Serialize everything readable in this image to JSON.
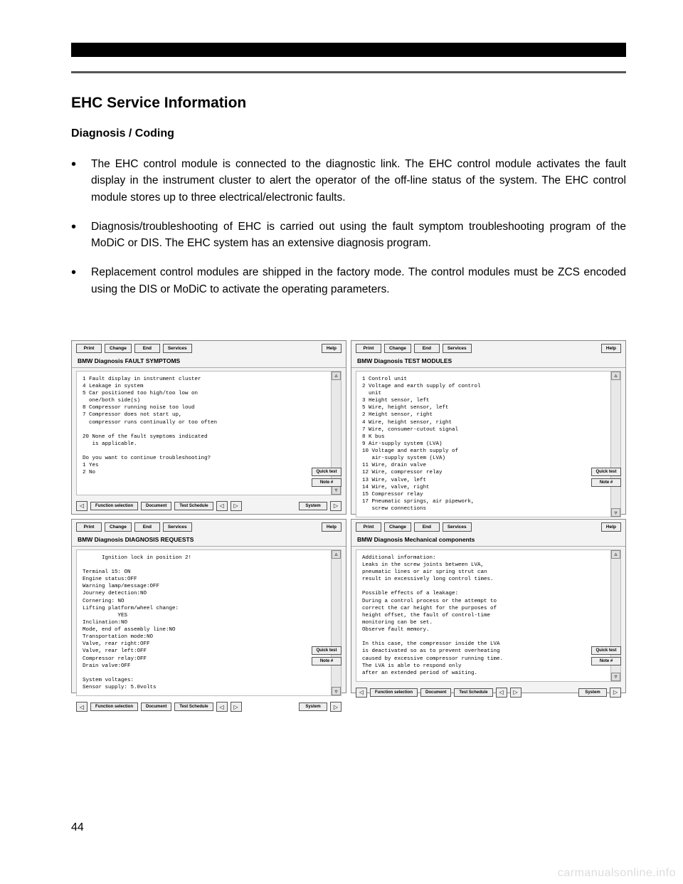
{
  "page": {
    "title": "EHC Service Information",
    "subtitle": "Diagnosis / Coding",
    "bullets": [
      "The EHC control module is connected to the diagnostic link. The EHC control module activates the fault display in the instrument cluster to alert the operator of the off-line status of the system.  The EHC control module stores up to three electrical/electronic faults.",
      "Diagnosis/troubleshooting of EHC is carried out using the fault symptom troubleshooting program of the MoDiC or DIS. The EHC system has an extensive diagnosis program.",
      "Replacement control modules are shipped in the factory mode. The control modules must be ZCS encoded using the DIS or MoDiC to activate the operating parameters."
    ],
    "page_number": "44",
    "watermark": "carmanualsonline.info"
  },
  "dis_buttons": {
    "print": "Print",
    "change": "Change",
    "end": "End",
    "services": "Services",
    "help": "Help",
    "function_selection": "Function\nselection",
    "document": "Document",
    "test_schedule": "Test\nSchedule",
    "system": "System",
    "quick_test": "Quick test",
    "note": "Note\n#"
  },
  "screens": [
    {
      "title": "BMW Diagnosis FAULT SYMPTOMS",
      "content": "1 Fault display in instrument cluster\n4 Leakage in system\n5 Car positioned too high/too low on\n  one/both side(s)\n8 Compressor running noise too loud\n7 Compressor does not start up,\n  compressor runs continually or too often\n\n20 None of the fault symptoms indicated\n   is applicable.\n\nDo you want to continue troubleshooting?\n1 Yes\n2 No"
    },
    {
      "title": "BMW Diagnosis TEST MODULES",
      "content": "1 Control unit\n2 Voltage and earth supply of control\n  unit\n3 Height sensor, left\n5 Wire, height sensor, left\n2 Height sensor, right\n4 Wire, height sensor, right\n7 Wire, consumer-cutout signal\n8 K bus\n9 Air-supply system (LVA)\n10 Voltage and earth supply of\n   air-supply system (LVA)\n11 Wire, drain valve\n12 Wire, compressor relay\n13 Wire, valve, left\n14 Wire, valve, right\n15 Compressor relay\n17 Pneumatic springs, air pipework,\n   screw connections"
    },
    {
      "title": "BMW Diagnosis DIAGNOSIS REQUESTS",
      "content": "      Ignition lock in position 2!\n\nTerminal 15: ON\nEngine status:OFF\nWarning lamp/message:OFF\nJourney detection:NO\nCornering: NO\nLifting platform/wheel change:\n           YES\nInclination:NO\nMode, end of assembly line:NO\nTransportation mode:NO\nValve, rear right:OFF\nValve, rear left:OFF\nCompressor relay:OFF\nDrain valve:OFF\n\nSystem voltages:\nSensor supply: 5.0volts"
    },
    {
      "title": "BMW Diagnosis Mechanical components",
      "content": "Additional information:\nLeaks in the screw joints between LVA,\npneumatic lines or air spring strut can\nresult in excessively long control times.\n\nPossible effects of a leakage:\nDuring a control process or the attempt to\ncorrect the car height for the purposes of\nheight offset, the fault of control-time\nmonitoring can be set.\nObserve fault memory.\n\nIn this case, the compressor inside the LVA\nis deactivated so as to prevent overheating\ncaused by excessive compressor running time.\nThe LVA is able to respond only\nafter an extended period of waiting."
    }
  ]
}
